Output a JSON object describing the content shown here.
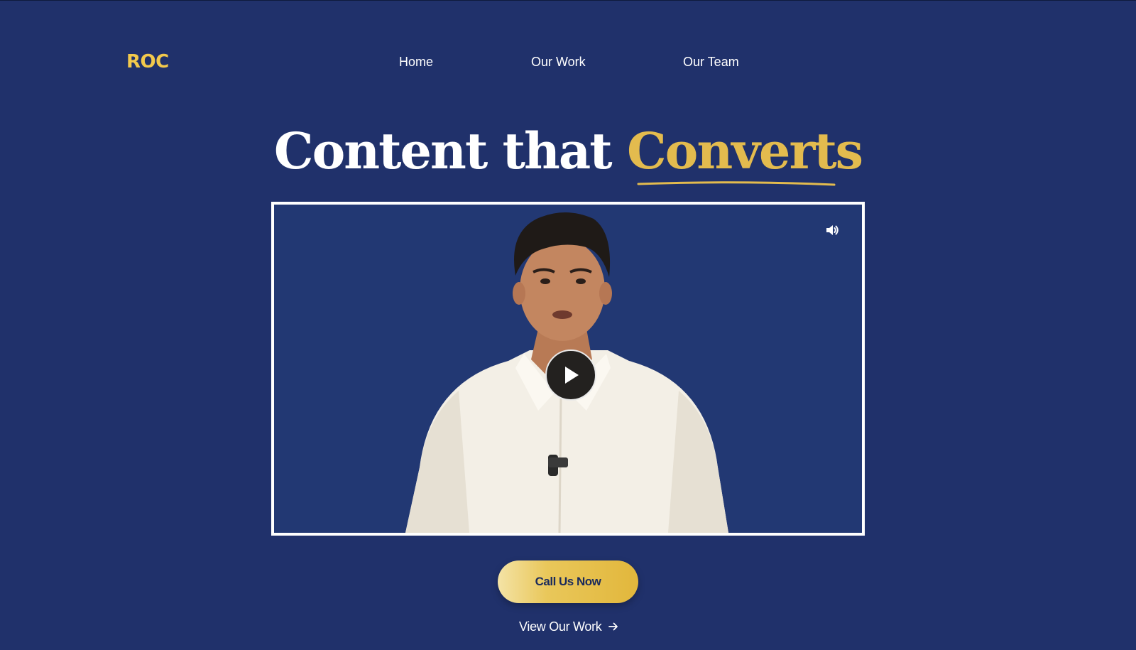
{
  "brand": {
    "logo_text": "ROC",
    "logo_color": "#f2c94c"
  },
  "nav": {
    "items": [
      {
        "label": "Home"
      },
      {
        "label": "Our Work"
      },
      {
        "label": "Our Team"
      }
    ]
  },
  "hero": {
    "headline_prefix": "Content that",
    "headline_accent": "Converts",
    "accent_color": "#e3bb4e"
  },
  "video": {
    "play_icon": "play-icon",
    "volume_icon": "volume-icon",
    "frame_color": "#ffffff"
  },
  "cta": {
    "primary_label": "Call Us Now",
    "secondary_label": "View Our Work",
    "secondary_icon": "arrow-right-icon"
  },
  "colors": {
    "background": "#20316b",
    "video_background": "#223873"
  }
}
